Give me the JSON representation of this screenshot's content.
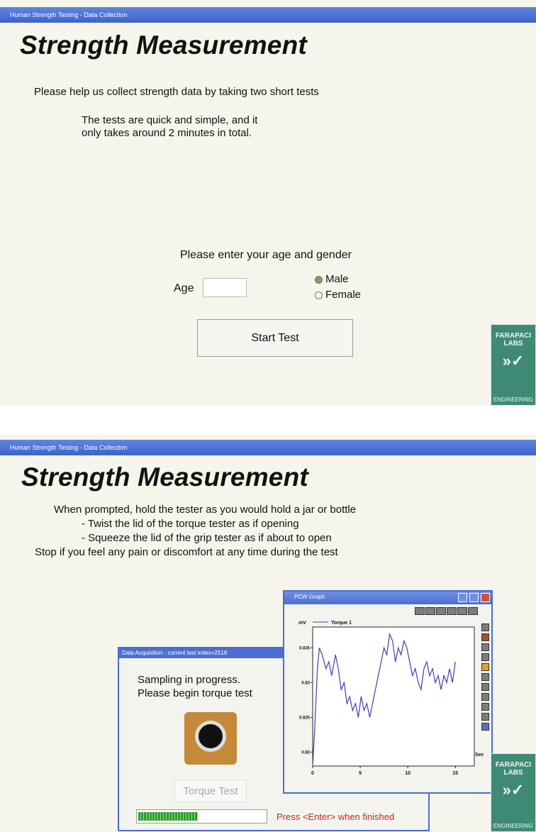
{
  "screen1": {
    "window_title": "Human Strength Testing - Data Collection",
    "heading": "Strength Measurement",
    "intro": "Please help us collect strength data by taking two short tests",
    "desc_line1": "The tests are quick and simple, and it",
    "desc_line2": "only takes around 2 minutes in total.",
    "prompt": "Please enter your age and gender",
    "age_label": "Age",
    "age_value": "",
    "gender_options": [
      "Male",
      "Female"
    ],
    "gender_selected": "Male",
    "start_button": "Start Test",
    "logo": {
      "line1": "FARAPACI",
      "line2": "LABS",
      "line3": "ENGINEERING"
    }
  },
  "screen2": {
    "window_title": "Human Strength Testing - Data Collection",
    "heading": "Strength Measurement",
    "instr1": "When prompted, hold the tester as you would hold a jar or bottle",
    "instr2": "- Twist the lid of the torque tester as if opening",
    "instr3": "- Squeeze the lid of the grip tester as if about to open",
    "instr4": "Stop if you feel any pain or discomfort at any time during the test",
    "daq": {
      "title": "Data Acquisition - current test index=2518",
      "status1": "Sampling in progress.",
      "status2": "Please begin torque test",
      "button": "Torque Test",
      "progress": 0.47,
      "message": "Press <Enter> when finished"
    },
    "graph": {
      "title": "PCW Graph",
      "y_unit": "mV",
      "x_unit": "Sec"
    },
    "logo": {
      "line1": "FARAPACI",
      "line2": "LABS",
      "line3": "ENGINEERING"
    }
  },
  "chart_data": {
    "type": "line",
    "series": [
      {
        "name": "Torque 1",
        "color": "#3b3fb8"
      }
    ],
    "x_ticks": [
      "0",
      "5",
      "10",
      "15"
    ],
    "y_ticks": [
      "0.82",
      "0.825",
      "0.83",
      "0.835"
    ],
    "xlim": [
      0,
      17
    ],
    "ylim": [
      0.818,
      0.838
    ],
    "points": [
      [
        0,
        0.818
      ],
      [
        0.2,
        0.823
      ],
      [
        0.5,
        0.832
      ],
      [
        0.7,
        0.835
      ],
      [
        1,
        0.834
      ],
      [
        1.4,
        0.832
      ],
      [
        1.7,
        0.833
      ],
      [
        2,
        0.831
      ],
      [
        2.4,
        0.834
      ],
      [
        2.7,
        0.832
      ],
      [
        3,
        0.829
      ],
      [
        3.3,
        0.83
      ],
      [
        3.6,
        0.827
      ],
      [
        3.9,
        0.828
      ],
      [
        4.2,
        0.826
      ],
      [
        4.5,
        0.827
      ],
      [
        4.8,
        0.825
      ],
      [
        5.1,
        0.828
      ],
      [
        5.4,
        0.826
      ],
      [
        5.7,
        0.827
      ],
      [
        6,
        0.825
      ],
      [
        6.3,
        0.827
      ],
      [
        6.6,
        0.829
      ],
      [
        6.9,
        0.831
      ],
      [
        7.2,
        0.833
      ],
      [
        7.5,
        0.835
      ],
      [
        7.8,
        0.834
      ],
      [
        8.1,
        0.837
      ],
      [
        8.4,
        0.836
      ],
      [
        8.7,
        0.833
      ],
      [
        9,
        0.835
      ],
      [
        9.3,
        0.834
      ],
      [
        9.6,
        0.836
      ],
      [
        9.9,
        0.835
      ],
      [
        10.2,
        0.833
      ],
      [
        10.5,
        0.831
      ],
      [
        10.8,
        0.832
      ],
      [
        11.1,
        0.83
      ],
      [
        11.4,
        0.829
      ],
      [
        11.7,
        0.832
      ],
      [
        12,
        0.833
      ],
      [
        12.3,
        0.831
      ],
      [
        12.6,
        0.832
      ],
      [
        12.9,
        0.83
      ],
      [
        13.2,
        0.831
      ],
      [
        13.5,
        0.829
      ],
      [
        13.8,
        0.831
      ],
      [
        14.1,
        0.83
      ],
      [
        14.4,
        0.832
      ],
      [
        14.7,
        0.83
      ],
      [
        15,
        0.833
      ]
    ]
  }
}
